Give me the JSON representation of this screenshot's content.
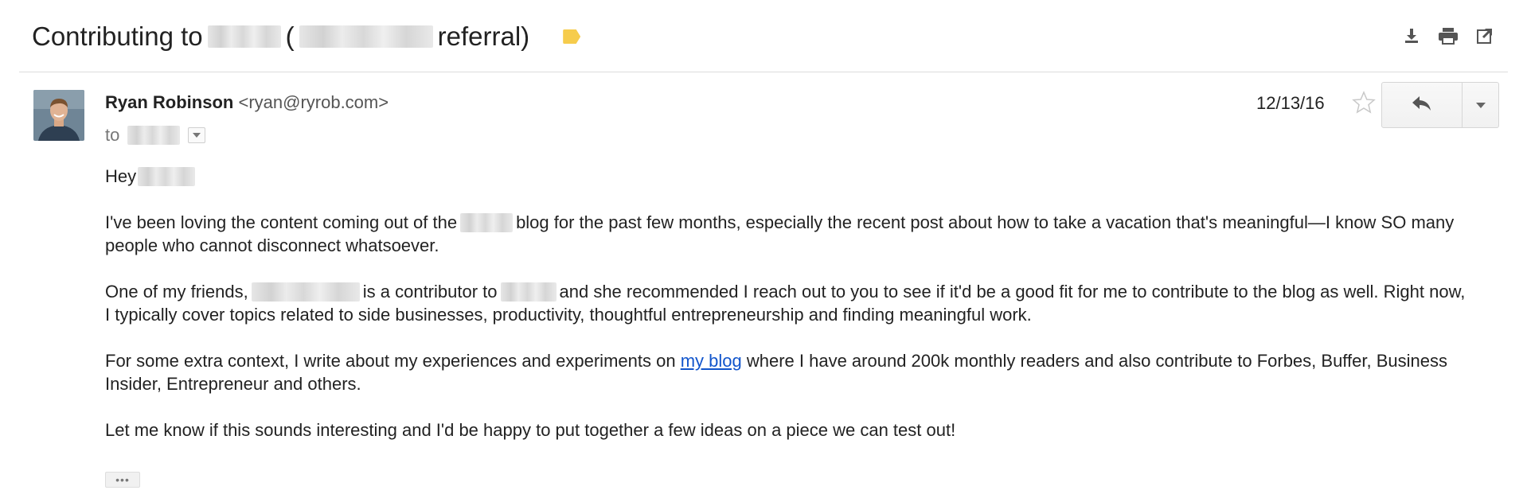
{
  "subject": {
    "prefix": "Contributing to",
    "open_paren": "(",
    "suffix": "referral)"
  },
  "sender": {
    "name": "Ryan Robinson",
    "email": "<ryan@ryrob.com>",
    "to_label": "to"
  },
  "date": "12/13/16",
  "body": {
    "greeting": "Hey",
    "p1_before": "I've been loving the content coming out of the",
    "p1_after": "blog for the past few months, especially the recent post about how to take a vacation that's meaningful—I know SO many people who cannot disconnect whatsoever.",
    "p2_before": "One of my friends,",
    "p2_mid": "is a contributor to",
    "p2_after": "and she recommended I reach out to you to see if it'd be a good fit for me to contribute to the blog as well. Right now, I typically cover topics related to side businesses, productivity, thoughtful entrepreneurship and finding meaningful work.",
    "p3_before": "For some extra context, I write about my experiences and experiments on",
    "p3_link": "my blog",
    "p3_after": "where I have around 200k monthly readers and also contribute to Forbes, Buffer, Business Insider, Entrepreneur and others.",
    "p4": "Let me know if this sounds interesting and I'd be happy to put together a few ideas on a piece we can test out!",
    "ellipsis": "•••"
  },
  "icons": {
    "download": "download-icon",
    "print": "print-icon",
    "new_window": "open-in-new-window-icon",
    "star": "star-icon",
    "reply": "reply-icon",
    "more": "chevron-down-icon",
    "label": "label-icon"
  },
  "colors": {
    "link": "#1155cc",
    "label": "#f6cc4c",
    "divider": "#dcdcdc"
  }
}
